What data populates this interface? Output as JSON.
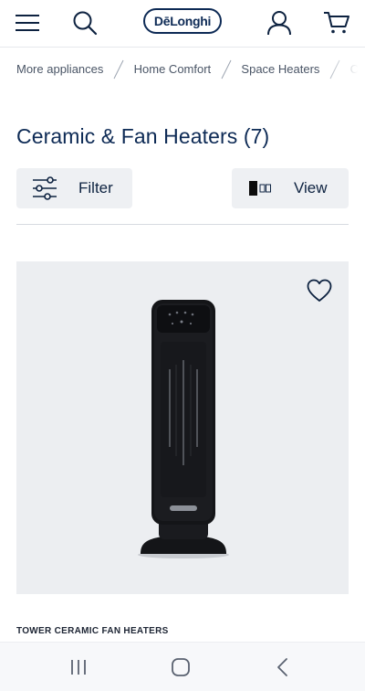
{
  "header": {
    "menu_icon": "hamburger-menu-icon",
    "search_icon": "search-icon",
    "logo_text": "DēLonghi",
    "account_icon": "user-icon",
    "cart_icon": "cart-icon"
  },
  "breadcrumb": {
    "items": [
      "More appliances",
      "Home Comfort",
      "Space Heaters",
      "Ce"
    ]
  },
  "page": {
    "title": "Ceramic & Fan Heaters (7)"
  },
  "controls": {
    "filter_label": "Filter",
    "filter_icon": "sliders-icon",
    "view_label": "View",
    "view_icon": "grid-view-icon"
  },
  "product": {
    "favorite_icon": "heart-icon",
    "image_icon": "tower-heater-image",
    "category": "TOWER CERAMIC FAN HEATERS",
    "colors": {
      "card_bg": "#eceef1",
      "device": "#141518"
    }
  },
  "system_nav": {
    "recents_icon": "recents-icon",
    "home_icon": "home-icon",
    "back_icon": "back-icon"
  },
  "colors": {
    "brand_navy": "#0d2a55",
    "button_bg": "#eef0f3"
  }
}
